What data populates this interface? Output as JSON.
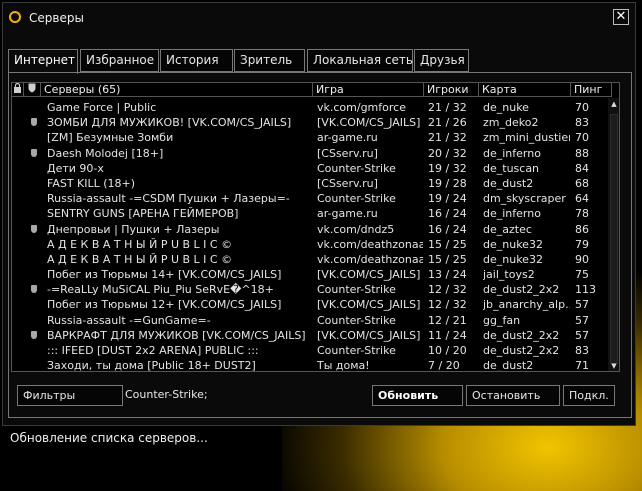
{
  "window": {
    "title": "Серверы"
  },
  "tabs": [
    {
      "label": "Интернет",
      "active": true
    },
    {
      "label": "Избранное"
    },
    {
      "label": "История"
    },
    {
      "label": "Зритель"
    },
    {
      "label": "Локальная сеть"
    },
    {
      "label": "Друзья"
    }
  ],
  "list": {
    "columns": {
      "servers": "Серверы (65)",
      "game": "Игра",
      "players": "Игроки",
      "map": "Карта",
      "ping": "Пинг"
    },
    "rows": [
      {
        "secure": false,
        "name": "Game Force | Public",
        "game": "vk.com/gmforce",
        "players": "21 / 32",
        "map": "de_nuke",
        "ping": "70"
      },
      {
        "secure": true,
        "name": "ЗОМБИ ДЛЯ МУЖИКОВ! [VK.COM/CS_JAILS]",
        "game": "[VK.COM/CS_JAILS]",
        "players": "21 / 26",
        "map": "zm_deko2",
        "ping": "83"
      },
      {
        "secure": false,
        "name": "[ZM] Безумные Зомби",
        "game": "ar-game.ru",
        "players": "21 / 32",
        "map": "zm_mini_dustier",
        "ping": "70"
      },
      {
        "secure": true,
        "name": "Daesh Molodej [18+]",
        "game": "[CSserv.ru]",
        "players": "20 / 32",
        "map": "de_inferno",
        "ping": "88"
      },
      {
        "secure": false,
        "name": "Дети 90-х",
        "game": "Counter-Strike",
        "players": "19 / 32",
        "map": "de_tuscan",
        "ping": "84"
      },
      {
        "secure": false,
        "name": "FAST KILL (18+)",
        "game": "[CSserv.ru]",
        "players": "19 / 28",
        "map": "de_dust2",
        "ping": "68"
      },
      {
        "secure": false,
        "name": "Russia-assault -=CSDM Пушки + Лазеры=-",
        "game": "Counter-Strike",
        "players": "19 / 24",
        "map": "dm_skyscraper",
        "ping": "64"
      },
      {
        "secure": false,
        "name": "SENTRY GUNS [АРЕНА ГЕЙМЕРОВ]",
        "game": "ar-game.ru",
        "players": "16 / 24",
        "map": "de_inferno",
        "ping": "78"
      },
      {
        "secure": true,
        "name": "Днепровьи | Пушки + Лазеры",
        "game": "vk.com/dndz5",
        "players": "16 / 24",
        "map": "de_aztec",
        "ping": "86"
      },
      {
        "secure": false,
        "name": "А Д Е К В А Т Н Ы Й     P U B L I C ©",
        "game": "vk.com/deathzonaa",
        "players": "15 / 25",
        "map": "de_nuke32",
        "ping": "79"
      },
      {
        "secure": false,
        "name": "А Д Е К В А Т Н Ы Й     P U B L I C ©",
        "game": "vk.com/deathzonaa",
        "players": "15 / 25",
        "map": "de_nuke32",
        "ping": "90"
      },
      {
        "secure": false,
        "name": "Побег из Тюрьмы 14+ [VK.COM/CS_JAILS]",
        "game": "[VK.COM/CS_JAILS]",
        "players": "13 / 24",
        "map": "jail_toys2",
        "ping": "75"
      },
      {
        "secure": true,
        "name": "-=ReaLLy MuSiCAL Piu_Piu SeRvE�^18+",
        "game": "Counter-Strike",
        "players": "12 / 32",
        "map": "de_dust2_2x2",
        "ping": "113"
      },
      {
        "secure": false,
        "name": "Побег из Тюрьмы 12+ [VK.COM/CS_JAILS]",
        "game": "[VK.COM/CS_JAILS]",
        "players": "12 / 32",
        "map": "jb_anarchy_alp...",
        "ping": "57"
      },
      {
        "secure": false,
        "name": "Russia-assault -=GunGame=-",
        "game": "Counter-Strike",
        "players": "12 / 21",
        "map": "gg_fan",
        "ping": "57"
      },
      {
        "secure": true,
        "name": "ВАРКРАФТ ДЛЯ МУЖИКОВ [VK.COM/CS_JAILS]",
        "game": "[VK.COM/CS_JAILS]",
        "players": "11 / 24",
        "map": "de_dust2_2x2",
        "ping": "57"
      },
      {
        "secure": false,
        "name": "::: IFEED [DUST 2x2 ARENA] PUBLIC :::",
        "game": "Counter-Strike",
        "players": "10 / 20",
        "map": "de_dust2_2x2",
        "ping": "83"
      },
      {
        "secure": false,
        "name": "Заходи, ты дома [Public 18+ DUST2]",
        "game": "Ты дома!",
        "players": "7 / 20",
        "map": "de_dust2",
        "ping": "71"
      }
    ]
  },
  "footer": {
    "filters_label": "Фильтры",
    "filter_value": "Counter-Strike;",
    "refresh_label": "Обновить",
    "stop_label": "Остановить",
    "connect_label": "Подкл."
  },
  "status": {
    "text": "Обновление списка серверов..."
  },
  "colors": {
    "accent": "#f2c400",
    "border": "#777777",
    "text": "#e8e8e8"
  }
}
